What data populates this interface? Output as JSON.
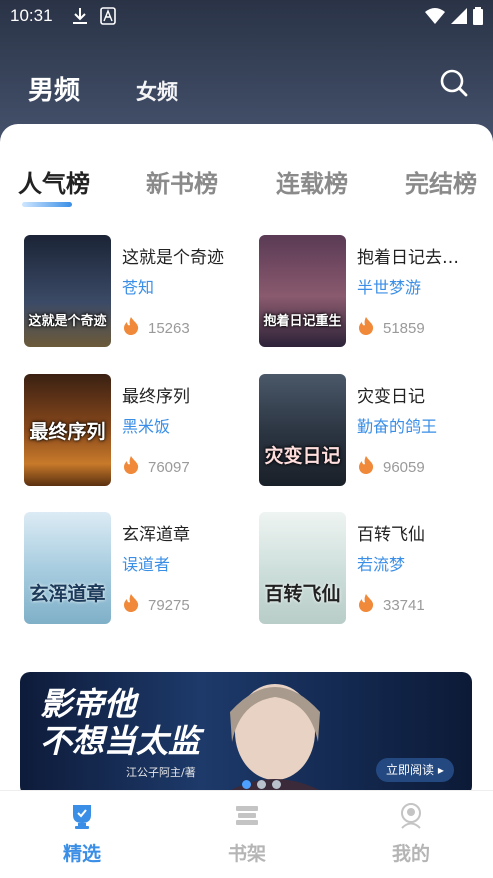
{
  "status_bar": {
    "time": "10:31"
  },
  "gender_tabs": [
    {
      "label": "男频",
      "active": true
    },
    {
      "label": "女频",
      "active": false
    }
  ],
  "rank_tabs": [
    {
      "label": "人气榜",
      "active": true
    },
    {
      "label": "新书榜",
      "active": false
    },
    {
      "label": "连载榜",
      "active": false
    },
    {
      "label": "完结榜",
      "active": false
    }
  ],
  "books": [
    {
      "title": "这就是个奇迹",
      "author": "苍知",
      "heat": "15263",
      "cover_text": "这就是个奇迹",
      "cover_color": "#2a3a55"
    },
    {
      "title": "抱着日记去…",
      "author": "半世梦游",
      "heat": "51859",
      "cover_text": "抱着日记重生",
      "cover_color": "#4a2f46"
    },
    {
      "title": "最终序列",
      "author": "黑米饭",
      "heat": "76097",
      "cover_text": "最终序列",
      "cover_color": "#6a3a1a"
    },
    {
      "title": "灾变日记",
      "author": "勤奋的鸽王",
      "heat": "96059",
      "cover_text": "灾变日记",
      "cover_color": "#2c3644"
    },
    {
      "title": "玄浑道章",
      "author": "误道者",
      "heat": "79275",
      "cover_text": "玄浑道章",
      "cover_color": "#9fc3d8"
    },
    {
      "title": "百转飞仙",
      "author": "若流梦",
      "heat": "33741",
      "cover_text": "百转飞仙",
      "cover_color": "#cfe0de"
    }
  ],
  "banner": {
    "title_line1": "影帝他",
    "title_line2": "不想当太监",
    "author": "江公子阿主/著",
    "button": "立即阅读 ▸",
    "active_dot": 0
  },
  "bottom_nav": [
    {
      "label": "精选",
      "icon": "trophy-icon",
      "active": true
    },
    {
      "label": "书架",
      "icon": "bookshelf-icon",
      "active": false
    },
    {
      "label": "我的",
      "icon": "profile-icon",
      "active": false
    }
  ],
  "colors": {
    "accent": "#3a8ee6",
    "heat": "#f08a3a",
    "header": "#2f3a52"
  }
}
